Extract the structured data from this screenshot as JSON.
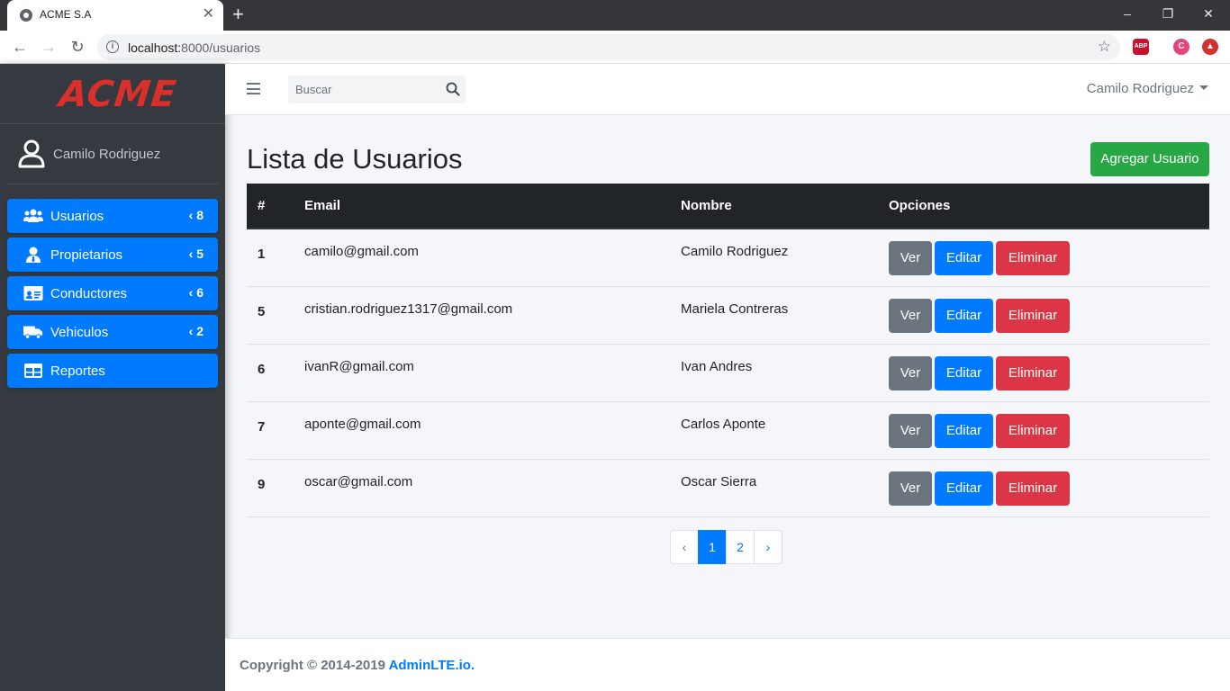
{
  "browser": {
    "tab_title": "ACME S.A",
    "tab_close": "✕",
    "new_tab": "+",
    "url_host": "localhost:",
    "url_path": "8000/usuarios",
    "ext_abp": "ABP",
    "ext_c": "C"
  },
  "sidebar": {
    "brand": "ACME",
    "user_name": "Camilo Rodriguez",
    "items": [
      {
        "label": "Usuarios",
        "badge": "8",
        "icon": "users-icon"
      },
      {
        "label": "Propietarios",
        "badge": "5",
        "icon": "user-tie-icon"
      },
      {
        "label": "Conductores",
        "badge": "6",
        "icon": "id-card-icon"
      },
      {
        "label": "Vehiculos",
        "badge": "2",
        "icon": "truck-icon"
      },
      {
        "label": "Reportes",
        "badge": "",
        "icon": "table-icon"
      }
    ]
  },
  "navbar": {
    "search_placeholder": "Buscar",
    "user_name": "Camilo Rodriguez"
  },
  "main": {
    "title": "Lista de Usuarios",
    "add_button": "Agregar Usuario",
    "table": {
      "headers": [
        "#",
        "Email",
        "Nombre",
        "Opciones"
      ],
      "rows": [
        {
          "id": "1",
          "email": "camilo@gmail.com",
          "name": "Camilo Rodriguez"
        },
        {
          "id": "5",
          "email": "cristian.rodriguez1317@gmail.com",
          "name": "Mariela Contreras"
        },
        {
          "id": "6",
          "email": "ivanR@gmail.com",
          "name": "Ivan Andres"
        },
        {
          "id": "7",
          "email": "aponte@gmail.com",
          "name": "Carlos Aponte"
        },
        {
          "id": "9",
          "email": "oscar@gmail.com",
          "name": "Oscar Sierra"
        }
      ],
      "actions": {
        "view": "Ver",
        "edit": "Editar",
        "delete": "Eliminar"
      }
    },
    "pagination": {
      "prev": "‹",
      "pages": [
        "1",
        "2"
      ],
      "active": "1",
      "next": "›"
    }
  },
  "footer": {
    "copyright": "Copyright © 2014-2019 ",
    "link": "AdminLTE.io."
  },
  "colors": {
    "primary": "#007bff",
    "success": "#28a745",
    "danger": "#dc3545",
    "secondary": "#6c757d",
    "sidebar_bg": "#343a40",
    "brand_red": "#d9302c"
  }
}
